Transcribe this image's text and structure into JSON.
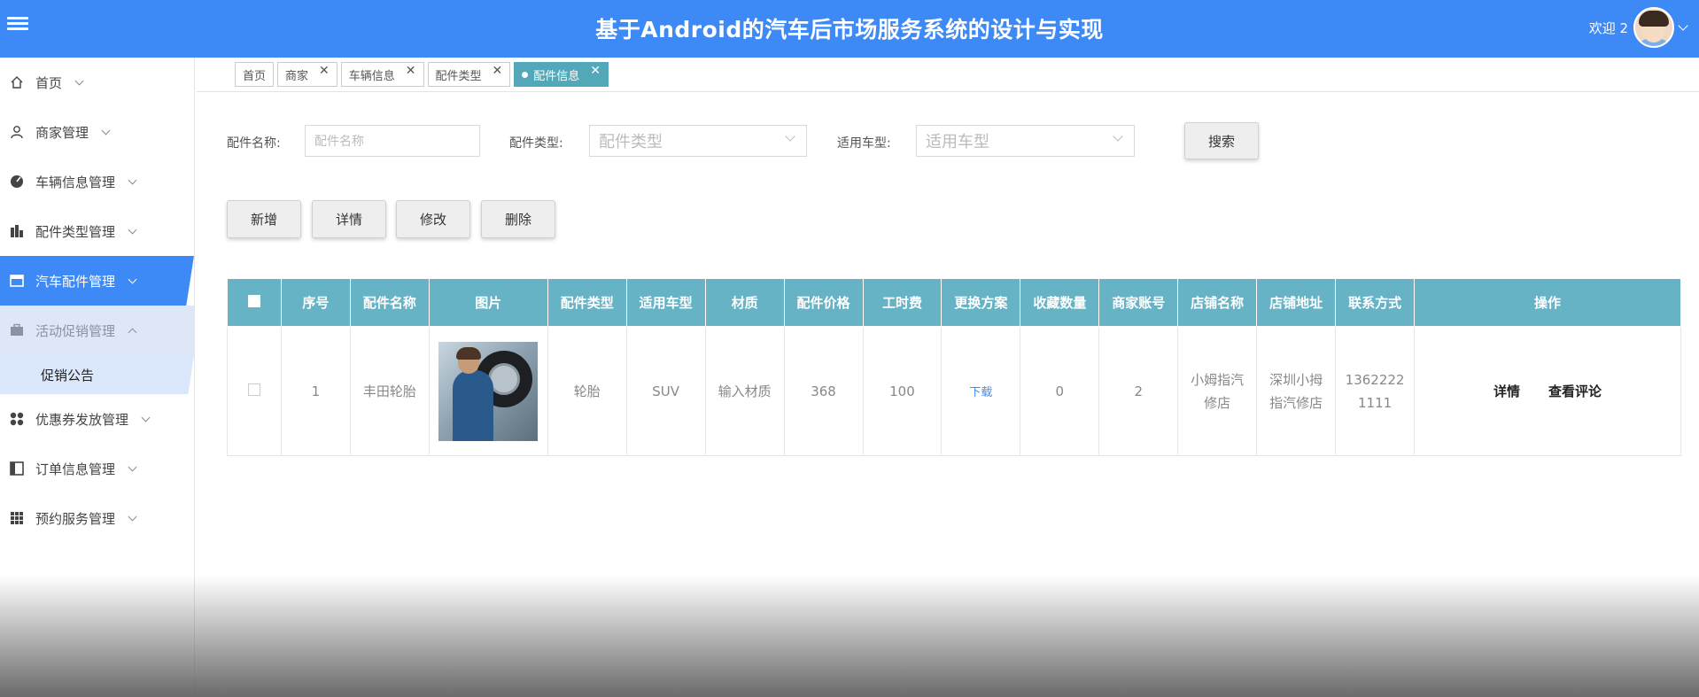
{
  "header": {
    "title": "基于Android的汽车后市场服务系统的设计与实现",
    "welcome": "欢迎 2"
  },
  "sidebar": {
    "items": [
      {
        "label": "首页",
        "icon": "home-icon"
      },
      {
        "label": "商家管理",
        "icon": "user-icon"
      },
      {
        "label": "车辆信息管理",
        "icon": "pie-icon"
      },
      {
        "label": "配件类型管理",
        "icon": "building-icon"
      },
      {
        "label": "汽车配件管理",
        "icon": "card-icon"
      },
      {
        "label": "活动促销管理",
        "icon": "briefcase-icon"
      },
      {
        "label": "优惠券发放管理",
        "icon": "grid4-icon"
      },
      {
        "label": "订单信息管理",
        "icon": "panel-icon"
      },
      {
        "label": "预约服务管理",
        "icon": "apps-icon"
      }
    ],
    "sub_item": "促销公告"
  },
  "tabs": [
    "首页",
    "商家",
    "车辆信息",
    "配件类型",
    "配件信息"
  ],
  "search": {
    "name_label": "配件名称:",
    "name_placeholder": "配件名称",
    "type_label": "配件类型:",
    "type_placeholder": "配件类型",
    "model_label": "适用车型:",
    "model_placeholder": "适用车型",
    "button": "搜索"
  },
  "actions": {
    "add": "新增",
    "detail": "详情",
    "edit": "修改",
    "delete": "删除"
  },
  "table": {
    "headers": [
      "序号",
      "配件名称",
      "图片",
      "配件类型",
      "适用车型",
      "材质",
      "配件价格",
      "工时费",
      "更换方案",
      "收藏数量",
      "商家账号",
      "店铺名称",
      "店铺地址",
      "联系方式",
      "操作"
    ],
    "rows": [
      {
        "index": "1",
        "name": "丰田轮胎",
        "type": "轮胎",
        "model": "SUV",
        "material": "输入材质",
        "price": "368",
        "labor": "100",
        "plan": "下载",
        "favorites": "0",
        "merchant": "2",
        "shop_name": "小姆指汽修店",
        "shop_address": "深圳小拇指汽修店",
        "contact": "13622221111",
        "op_detail": "详情",
        "op_review": "查看评论"
      }
    ]
  },
  "colors": {
    "header": "#3d8af7",
    "table_header": "#66b3c6",
    "active_tab": "#52a7b8"
  }
}
